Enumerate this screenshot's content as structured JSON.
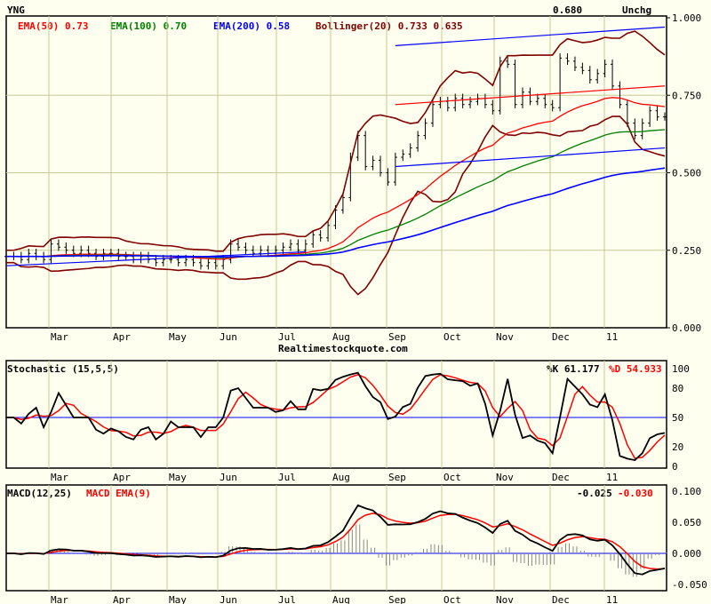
{
  "chart_data": {
    "type": "line",
    "symbol": "YNG",
    "last_price": "0.680",
    "change": "Unchg",
    "watermark": "Realtimestockquote.com",
    "months": [
      "Mar",
      "Apr",
      "May",
      "Jun",
      "Jul",
      "Aug",
      "Sep",
      "Oct",
      "Nov",
      "Dec",
      "11"
    ],
    "price_axis": {
      "ylim": [
        0,
        1
      ],
      "ticks": [
        "1.000",
        "0.750",
        "0.500",
        "0.250",
        "0.000"
      ]
    },
    "legend": {
      "ema50": "EMA(50) 0.73",
      "ema100": "EMA(100) 0.70",
      "ema200": "EMA(200) 0.58",
      "bollinger": "Bollinger(20) 0.733 0.635"
    },
    "colors": {
      "ema50": "#ff0000",
      "ema100": "#008000",
      "ema200": "#0000ff",
      "bollinger": "#800000",
      "grid": "#c8c896"
    },
    "closes": [
      0.23,
      0.23,
      0.22,
      0.24,
      0.23,
      0.22,
      0.27,
      0.26,
      0.25,
      0.24,
      0.25,
      0.24,
      0.23,
      0.24,
      0.24,
      0.23,
      0.23,
      0.22,
      0.23,
      0.22,
      0.21,
      0.22,
      0.22,
      0.21,
      0.22,
      0.21,
      0.2,
      0.21,
      0.2,
      0.22,
      0.27,
      0.26,
      0.25,
      0.24,
      0.25,
      0.24,
      0.25,
      0.26,
      0.27,
      0.25,
      0.27,
      0.3,
      0.29,
      0.33,
      0.38,
      0.42,
      0.55,
      0.62,
      0.52,
      0.54,
      0.5,
      0.47,
      0.55,
      0.56,
      0.58,
      0.62,
      0.66,
      0.72,
      0.73,
      0.71,
      0.74,
      0.72,
      0.73,
      0.74,
      0.72,
      0.7,
      0.86,
      0.85,
      0.72,
      0.76,
      0.73,
      0.74,
      0.72,
      0.71,
      0.87,
      0.86,
      0.84,
      0.83,
      0.8,
      0.82,
      0.85,
      0.78,
      0.72,
      0.66,
      0.62,
      0.66,
      0.7,
      0.68,
      0.68
    ],
    "trendlines": [
      {
        "from": [
          52,
          0.91
        ],
        "to": [
          88,
          0.97
        ],
        "color": "#0000ff"
      },
      {
        "from": [
          52,
          0.52
        ],
        "to": [
          88,
          0.58
        ],
        "color": "#0000ff"
      },
      {
        "from": [
          52,
          0.72
        ],
        "to": [
          88,
          0.78
        ],
        "color": "#ff0000"
      },
      {
        "from": [
          0,
          0.2
        ],
        "to": [
          40,
          0.245
        ],
        "color": "#0000ff"
      }
    ],
    "stochastic": {
      "title": "Stochastic (15,5,5)",
      "k_label": "%K 61.177",
      "d_label": "%D 54.933",
      "ticks": [
        "100",
        "80",
        "50",
        "20",
        "0"
      ],
      "ylim": [
        0,
        100
      ]
    },
    "macd": {
      "title": "MACD(12,25)",
      "signal_title": "MACD EMA(9)",
      "macd_value": "-0.025",
      "signal_value": "-0.030",
      "ticks": [
        "0.100",
        "0.050",
        "0.000",
        "-0.050"
      ],
      "ylim": [
        -0.06,
        0.11
      ]
    }
  }
}
